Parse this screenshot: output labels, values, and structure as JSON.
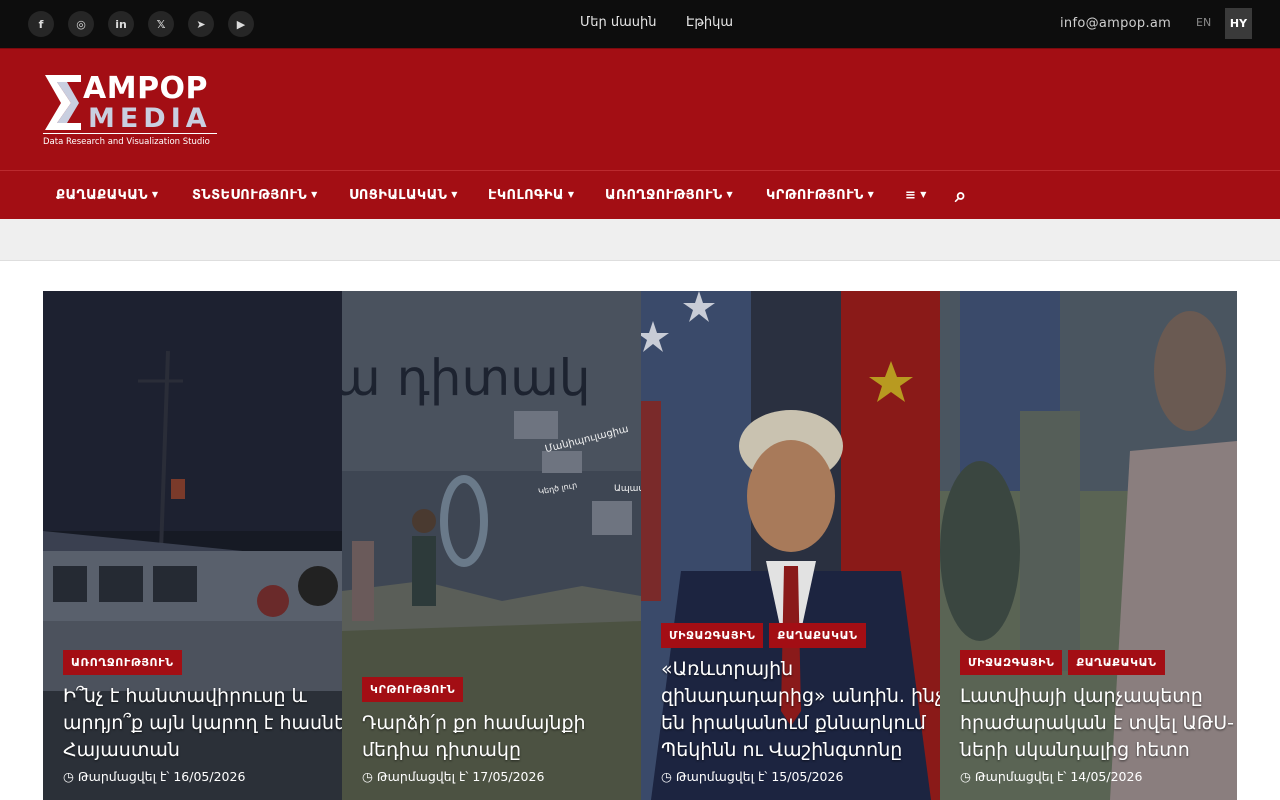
{
  "topbar": {
    "social": [
      {
        "name": "facebook",
        "glyph": "f"
      },
      {
        "name": "instagram",
        "glyph": "◎"
      },
      {
        "name": "linkedin",
        "glyph": "in"
      },
      {
        "name": "x",
        "glyph": "𝕏"
      },
      {
        "name": "telegram",
        "glyph": "➤"
      },
      {
        "name": "youtube",
        "glyph": "▶"
      }
    ],
    "links": [
      "Մեր մասին",
      "Էթիկա"
    ],
    "email": "info@ampop.am",
    "lang_en": "EN",
    "lang_hy": "HY"
  },
  "logo": {
    "line1": "AMPOP",
    "line2": "MEDIA",
    "tagline": "Data Research and Visualization Studio"
  },
  "nav": {
    "items": [
      "ՔԱՂԱՔԱԿԱՆ",
      "ՏՆՏԵՍՈՒԹՅՈՒՆ",
      "ՍՈՑԻԱԼԱԿԱՆ",
      "ԷԿՈԼՈԳԻԱ",
      "ԱՌՈՂՋՈՒԹՅՈՒՆ",
      "ԿՐԹՈՒԹՅՈՒՆ"
    ],
    "caret": "▼",
    "more_icon": "≡",
    "search_icon": "⌕"
  },
  "slides": [
    {
      "tags": [
        "ԱՌՈՂՋՈՒԹՅՈՒՆ"
      ],
      "title": "Ի՞նչ է հանտավիրուսը և\nարդյո՞ք այն կարող է հասնել\nՀայաստան",
      "date": "Թարմացվել է՝ 16/05/2026"
    },
    {
      "tags": [
        "ԿՐԹՈՒԹՅՈՒՆ"
      ],
      "title": "Դարձի՛ր քո համայնքի\nմեդիա դիտակը",
      "date": "Թարմացվել է՝ 17/05/2026",
      "image_text": [
        "ա դիտակ",
        "Մանիպուլացիա",
        "Կեղծ լուր",
        "Ապատեղեկ"
      ]
    },
    {
      "tags": [
        "ՄԻՋԱԶԳԱՅԻՆ",
        "ՔԱՂԱՔԱԿԱՆ"
      ],
      "title": "«Առևտրային\nզինադադարից» անդին. ինչ\nեն իրականում քննարկում\nՊեկինն ու Վաշինգտոնը",
      "date": "Թարմացվել է՝ 15/05/2026"
    },
    {
      "tags": [
        "ՄԻՋԱԶԳԱՅԻՆ",
        "ՔԱՂԱՔԱԿԱՆ"
      ],
      "title": "Լատվիայի վարչապետը\nհրաժարական է տվել ԱԹՍ-\nների սկանդալից հետո",
      "date": "Թարմացվել է՝ 14/05/2026"
    }
  ],
  "date_icon": "◷",
  "colors": {
    "brand_red": "#a30e14",
    "topbar": "#0d0d0d",
    "subbar": "#efefef"
  }
}
